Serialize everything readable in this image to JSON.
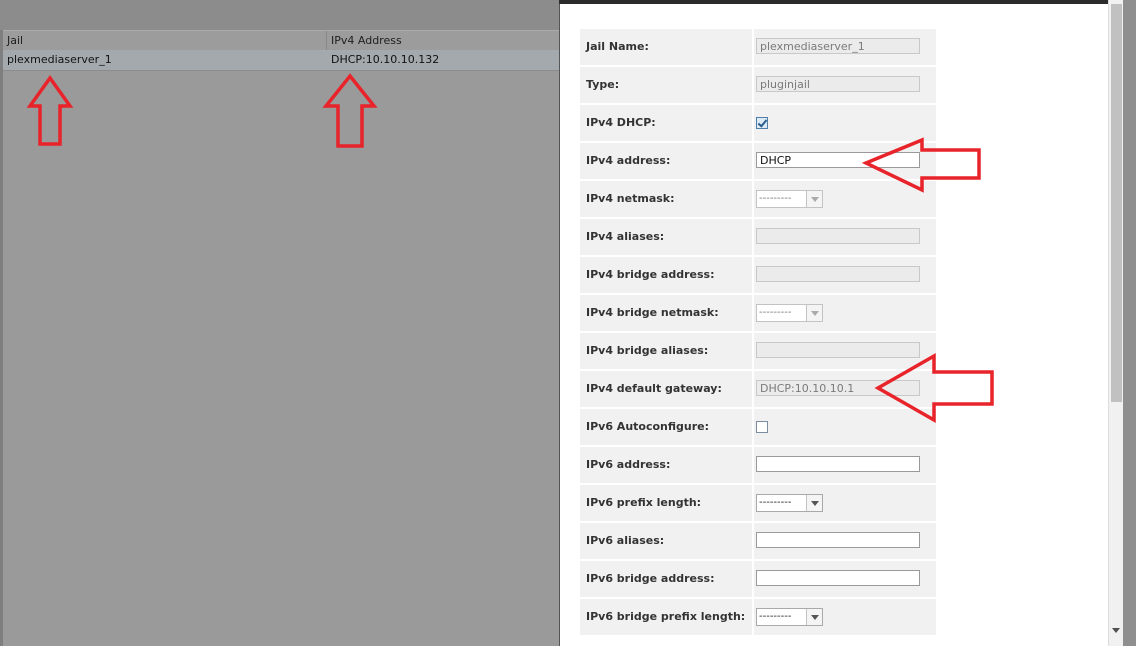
{
  "grid": {
    "columns": [
      "Jail",
      "IPv4 Address"
    ],
    "rows": [
      {
        "jail": "plexmediaserver_1",
        "ipv4": "DHCP:10.10.10.132"
      }
    ]
  },
  "form": {
    "jail_name": {
      "label": "Jail Name:",
      "value": "plexmediaserver_1"
    },
    "type": {
      "label": "Type:",
      "value": "pluginjail"
    },
    "ipv4_dhcp": {
      "label": "IPv4 DHCP:",
      "checked": true
    },
    "ipv4_address": {
      "label": "IPv4 address:",
      "value": "DHCP"
    },
    "ipv4_netmask": {
      "label": "IPv4 netmask:",
      "value": "---------"
    },
    "ipv4_aliases": {
      "label": "IPv4 aliases:",
      "value": ""
    },
    "ipv4_bridge_address": {
      "label": "IPv4 bridge address:",
      "value": ""
    },
    "ipv4_bridge_netmask": {
      "label": "IPv4 bridge netmask:",
      "value": "---------"
    },
    "ipv4_bridge_aliases": {
      "label": "IPv4 bridge aliases:",
      "value": ""
    },
    "ipv4_default_gateway": {
      "label": "IPv4 default gateway:",
      "value": "DHCP:10.10.10.1"
    },
    "ipv6_autoconfigure": {
      "label": "IPv6 Autoconfigure:",
      "checked": false
    },
    "ipv6_address": {
      "label": "IPv6 address:",
      "value": ""
    },
    "ipv6_prefix_length": {
      "label": "IPv6 prefix length:",
      "value": "---------"
    },
    "ipv6_aliases": {
      "label": "IPv6 aliases:",
      "value": ""
    },
    "ipv6_bridge_address": {
      "label": "IPv6 bridge address:",
      "value": ""
    },
    "ipv6_bridge_prefix_length": {
      "label": "IPv6 bridge prefix length:",
      "value": "---------"
    }
  },
  "colors": {
    "annotation_arrow": "#e8232a"
  }
}
